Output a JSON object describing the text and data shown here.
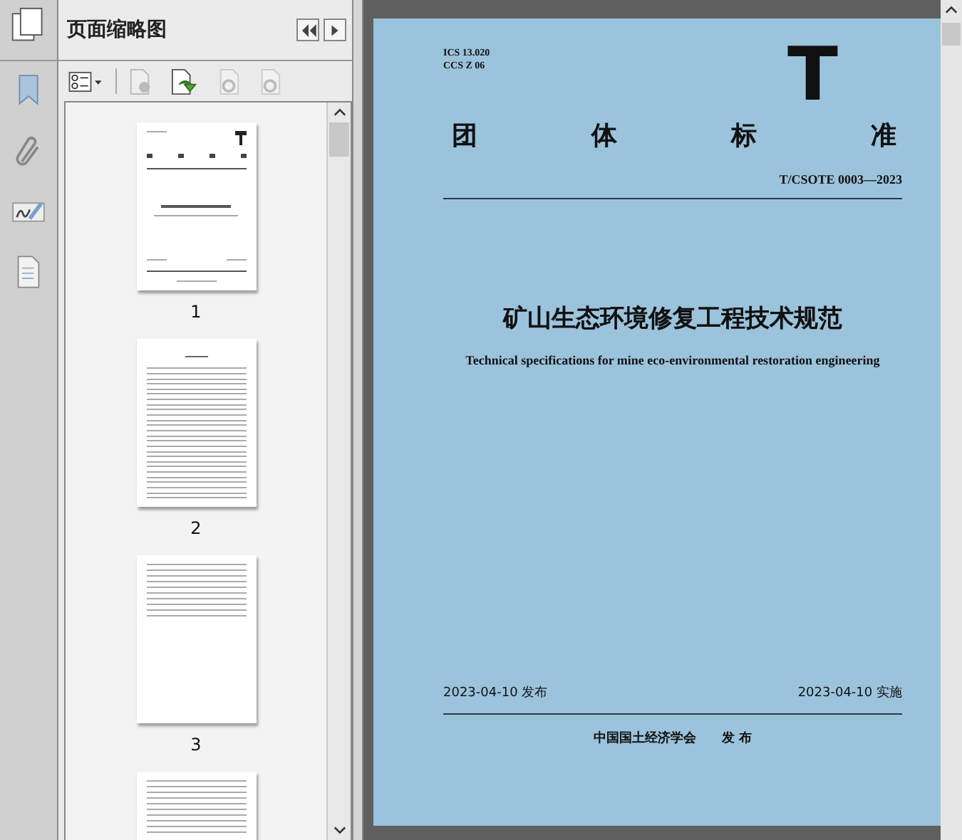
{
  "panel": {
    "title": "页面缩略图"
  },
  "thumbnails": [
    {
      "number": "1",
      "kind": "cover"
    },
    {
      "number": "2",
      "kind": "contents"
    },
    {
      "number": "3",
      "kind": "text"
    },
    {
      "kind": "text"
    }
  ],
  "document": {
    "ics": "ICS 13.020",
    "ccs": "CCS Z 06",
    "mark": "T",
    "category": [
      "团",
      "体",
      "标",
      "准"
    ],
    "code": "T/CSOTE 0003—2023",
    "title": "矿山生态环境修复工程技术规范",
    "subtitle": "Technical specifications for mine eco-environmental restoration engineering",
    "issued": "2023-04-10 发布",
    "effective": "2023-04-10 实施",
    "publisher": "中国国土经济学会",
    "publisher_action": "发 布"
  }
}
